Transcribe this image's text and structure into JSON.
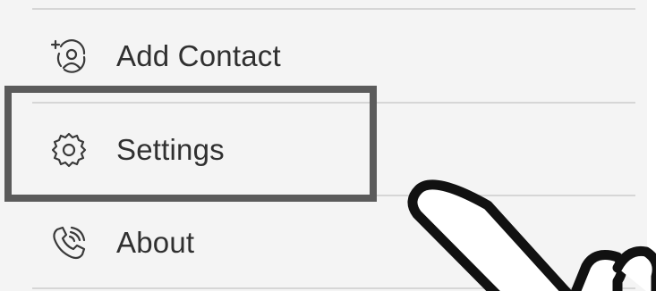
{
  "menu": {
    "items": [
      {
        "label": "Add Contact",
        "icon": "add-contact-icon"
      },
      {
        "label": "Settings",
        "icon": "gear-icon"
      },
      {
        "label": "About",
        "icon": "phone-viber-icon"
      }
    ]
  },
  "annotation": {
    "highlighted_item": "Settings",
    "pointer": "hand-pointer-overlay"
  },
  "colors": {
    "background": "#f4f4f4",
    "divider": "#d6d6d6",
    "text": "#303030",
    "highlight_border": "#5b5b5b"
  }
}
